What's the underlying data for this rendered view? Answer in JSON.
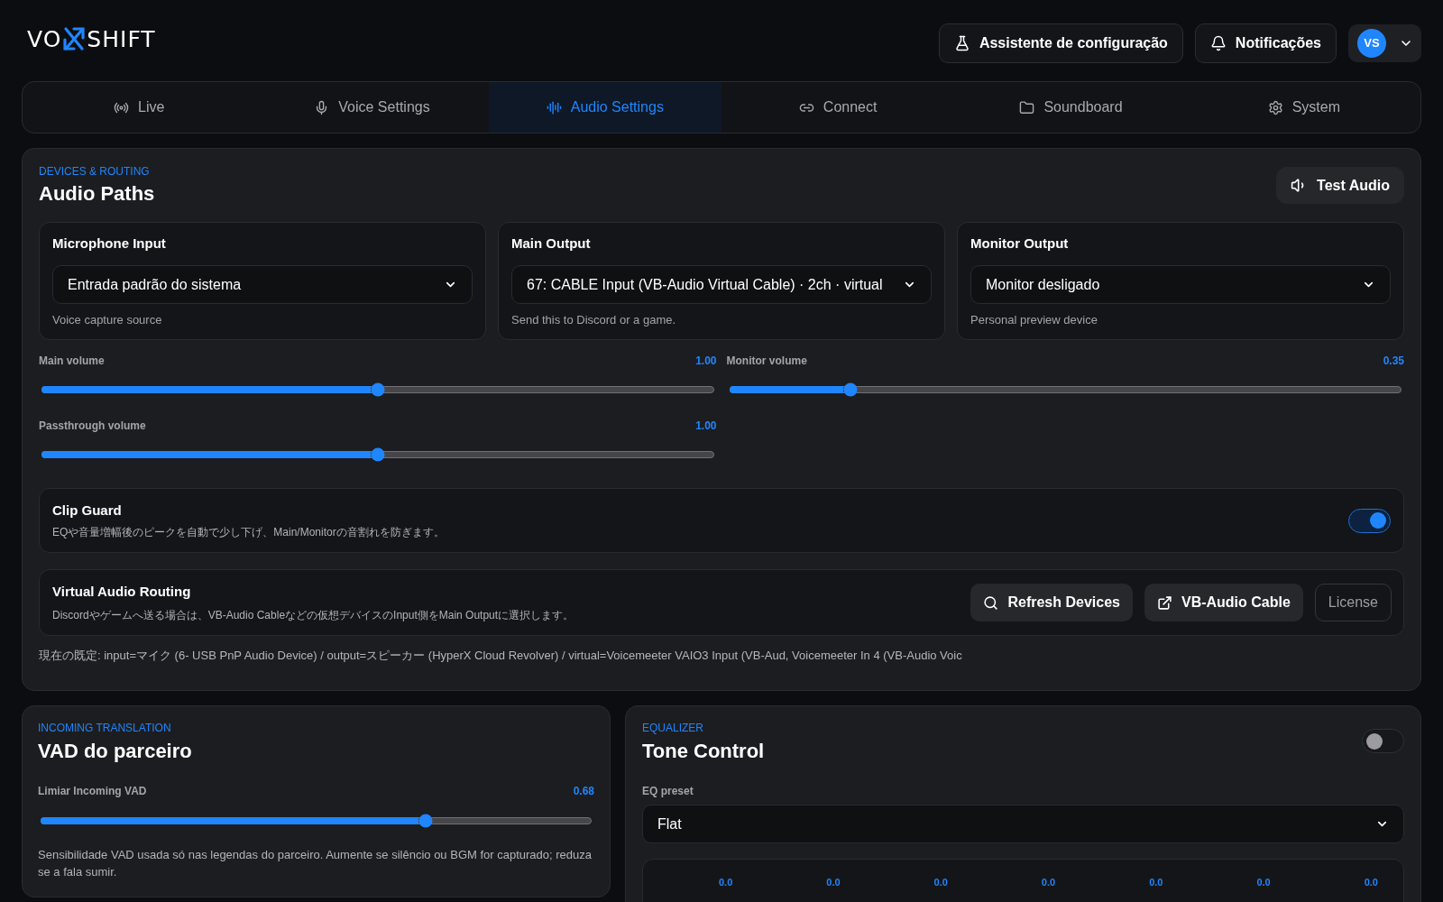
{
  "header": {
    "logo": {
      "left": "VO",
      "right": "SHIFT"
    },
    "actions": [
      {
        "label": "Assistente de configuração"
      },
      {
        "label": "Notificações"
      }
    ],
    "user": {
      "initials": "VS"
    }
  },
  "tabs": [
    {
      "label": "Live",
      "selected": false
    },
    {
      "label": "Voice Settings",
      "selected": false
    },
    {
      "label": "Audio Settings",
      "selected": true
    },
    {
      "label": "Connect",
      "selected": false
    },
    {
      "label": "Soundboard",
      "selected": false
    },
    {
      "label": "System",
      "selected": false
    }
  ],
  "audio_paths": {
    "eyebrow": "DEVICES & ROUTING",
    "title": "Audio Paths",
    "test_button": "Test Audio",
    "devices": [
      {
        "label": "Microphone Input",
        "value": "Entrada padrão do sistema",
        "hint": "Voice capture source"
      },
      {
        "label": "Main Output",
        "value": "67: CABLE Input (VB-Audio Virtual Cable) · 2ch · virtual",
        "hint": "Send this to Discord or a game."
      },
      {
        "label": "Monitor Output",
        "value": "Monitor desligado",
        "hint": "Personal preview device"
      }
    ],
    "sliders": [
      {
        "label": "Main volume",
        "reading": "1.00",
        "level": 0.5
      },
      {
        "label": "Monitor volume",
        "reading": "0.35",
        "level": 0.18
      },
      {
        "label": "Passthrough volume",
        "reading": "1.00",
        "level": 0.5
      }
    ],
    "clip_guard": {
      "title": "Clip Guard",
      "description": "EQや音量増幅後のピークを自動で少し下げ、Main/Monitorの音割れを防ぎます。",
      "on": true
    },
    "routing": {
      "title": "Virtual Audio Routing",
      "description": "Discordやゲームへ送る場合は、VB-Audio Cableなどの仮想デバイスのInput側をMain Outputに選択します。",
      "buttons": [
        {
          "label": "Refresh Devices",
          "kind": "filled"
        },
        {
          "label": "VB-Audio Cable",
          "kind": "filled"
        },
        {
          "label": "License",
          "kind": "outline"
        }
      ]
    },
    "current_defaults": "現在の既定: input=マイク (6- USB PnP Audio Device) / output=スピーカー (HyperX Cloud Revolver) / virtual=Voicemeeter VAIO3 Input (VB-Aud, Voicemeeter In 4 (VB-Audio Voic"
  },
  "incoming": {
    "eyebrow": "INCOMING TRANSLATION",
    "title": "VAD do parceiro",
    "slider": {
      "label": "Limiar Incoming VAD",
      "reading": "0.68",
      "level": 0.7
    },
    "description": "Sensibilidade VAD usada só nas legendas do parceiro. Aumente se silêncio ou BGM for capturado; reduza se a fala sumir."
  },
  "equalizer": {
    "eyebrow": "EQUALIZER",
    "title": "Tone Control",
    "on": false,
    "preset_label": "EQ preset",
    "preset": "Flat",
    "bands": [
      {
        "reading": "0.0"
      },
      {
        "reading": "0.0"
      },
      {
        "reading": "0.0"
      },
      {
        "reading": "0.0"
      },
      {
        "reading": "0.0"
      },
      {
        "reading": "0.0"
      },
      {
        "reading": "0.0"
      }
    ]
  }
}
